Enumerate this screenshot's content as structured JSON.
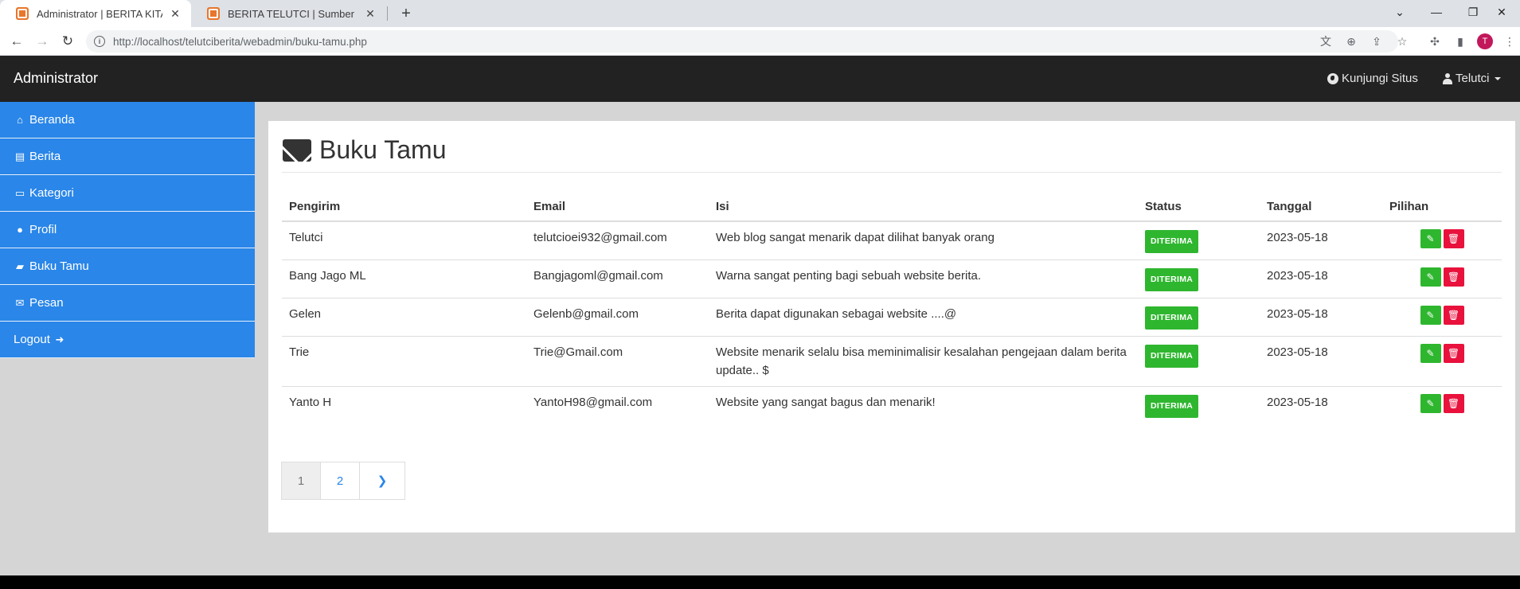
{
  "browser": {
    "tabs": [
      {
        "title": "Administrator | BERITA KITA",
        "active": true
      },
      {
        "title": "BERITA TELUTCI | Sumber berita t",
        "active": false
      }
    ],
    "url": "http://localhost/telutciberita/webadmin/buku-tamu.php",
    "profile_initial": "T"
  },
  "topnav": {
    "brand": "Administrator",
    "visit_site": "Kunjungi Situs",
    "user": "Telutci"
  },
  "sidebar": {
    "items": [
      {
        "label": "Beranda",
        "icon": "home-icon"
      },
      {
        "label": "Berita",
        "icon": "newspaper-icon"
      },
      {
        "label": "Kategori",
        "icon": "folder-icon"
      },
      {
        "label": "Profil",
        "icon": "user-icon"
      },
      {
        "label": "Buku Tamu",
        "icon": "book-icon"
      },
      {
        "label": "Pesan",
        "icon": "envelope-icon"
      },
      {
        "label": "Logout",
        "icon": "sign-out-icon"
      }
    ]
  },
  "main": {
    "title": "Buku Tamu",
    "table": {
      "headers": [
        "Pengirim",
        "Email",
        "Isi",
        "Status",
        "Tanggal",
        "Pilihan"
      ],
      "rows": [
        {
          "sender": "Telutci",
          "email": "telutcioei932@gmail.com",
          "message": "Web blog sangat menarik dapat dilihat banyak orang",
          "status": "DITERIMA",
          "date": "2023-05-18"
        },
        {
          "sender": "Bang Jago ML",
          "email": "Bangjagoml@gmail.com",
          "message": "Warna sangat penting bagi sebuah website berita.",
          "status": "DITERIMA",
          "date": "2023-05-18"
        },
        {
          "sender": "Gelen",
          "email": "Gelenb@gmail.com",
          "message": "Berita dapat digunakan sebagai website ....@",
          "status": "DITERIMA",
          "date": "2023-05-18"
        },
        {
          "sender": "Trie",
          "email": "Trie@Gmail.com",
          "message": "Website menarik selalu bisa meminimalisir kesalahan pengejaan dalam berita update.. $",
          "status": "DITERIMA",
          "date": "2023-05-18"
        },
        {
          "sender": "Yanto H",
          "email": "YantoH98@gmail.com",
          "message": "Website yang sangat bagus dan menarik!",
          "status": "DITERIMA",
          "date": "2023-05-18"
        }
      ]
    },
    "pagination": {
      "pages": [
        "1",
        "2"
      ],
      "current": "1",
      "next_icon": "chevron-right-icon"
    }
  },
  "colors": {
    "sidebar": "#2a86e8",
    "topnav": "#222222",
    "status_badge": "#2fb62f",
    "delete_button": "#e8123c"
  }
}
